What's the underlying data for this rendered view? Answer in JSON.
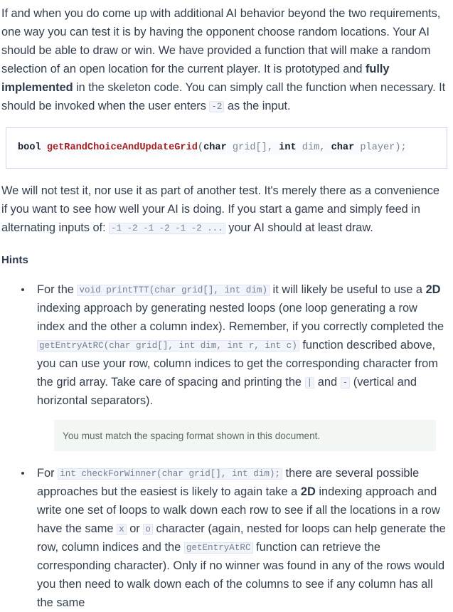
{
  "document": {
    "paragraph_1": {
      "part_1": "If and when you do come up with additional AI behavior beyond the two requirements, one way you can test it is by having the opponent choose random locations. Your AI should be able to draw or win. We have provided a function that will make a random selection of an open location for the current player. It is prototyped and ",
      "bold_1": "fully implemented",
      "part_2": " in the skeleton code. You can simply call the function when necessary. It should be invoked when the user enters ",
      "code_1": "-2",
      "part_3": " as the input."
    },
    "code_block": {
      "tokens": [
        {
          "text": "bool",
          "type": "keyword"
        },
        {
          "text": " ",
          "type": "plain"
        },
        {
          "text": "getRandChoiceAndUpdateGrid",
          "type": "function"
        },
        {
          "text": "(",
          "type": "punct"
        },
        {
          "text": "char",
          "type": "keyword"
        },
        {
          "text": " grid[], ",
          "type": "plain"
        },
        {
          "text": "int",
          "type": "keyword"
        },
        {
          "text": " dim, ",
          "type": "plain"
        },
        {
          "text": "char",
          "type": "keyword"
        },
        {
          "text": " player);",
          "type": "plain"
        }
      ],
      "full_text": "bool getRandChoiceAndUpdateGrid(char grid[], int dim, char player);",
      "return_type": "bool",
      "function_name": "getRandChoiceAndUpdateGrid",
      "params": "(char grid[], int dim, char player);"
    },
    "paragraph_2": {
      "part_1": "We will not test it, nor use it as part of another test. It's merely there as a convenience if you want to see how well your AI is doing. If you start a game and simply feed in alternating inputs of: ",
      "code_1": "-1 -2 -1 -2 -1 -2 ...",
      "part_2": " your AI should at least draw."
    },
    "hints_heading": "Hints",
    "hints": [
      {
        "part_1": "For the ",
        "code_1": "void printTTT(char grid[], int dim)",
        "part_2": " it will likely be useful to use a ",
        "bold_1": "2D",
        "part_3": " indexing approach by generating nested loops (one loop generating a row index and the other a column index). Remember, if you correctly completed the ",
        "code_2": "getEntryAtRC(char grid[], int dim, int r, int c)",
        "part_4": " function described above, you can use your row, column indices to get the corresponding character from the grid array. Take care of spacing and printing the ",
        "code_3": "|",
        "part_5": " and ",
        "code_4": "-",
        "part_6": " (vertical and horizontal separators).",
        "note": "You must match the spacing format shown in this document."
      },
      {
        "part_1": "For ",
        "code_1": "int checkForWinner(char grid[], int dim);",
        "part_2": " there are several possible approaches but the easiest is likely to again take a ",
        "bold_1": "2D",
        "part_3": " indexing approach and write one set of loops to walk down each row to see if all the locations in a row have the same ",
        "code_2": "x",
        "part_4": " or ",
        "code_3": "o",
        "part_5": " character (again, nested for loops can help generate the row, column indices and the ",
        "code_4": "getEntryAtRC",
        "part_6": " function can retrieve the corresponding character). Only if no winner was found in any of the rows would you then need to walk down each of the columns to see if any column has all the same"
      }
    ],
    "colors": {
      "body_text": "#34404f",
      "heading": "#2b3950",
      "inline_code_bg": "#f1f4fa",
      "inline_code_border": "#dfe5f2",
      "inline_code_text": "#76808f",
      "code_block_border": "#ccd6ec",
      "code_keyword": "#19202b",
      "code_function": "#a41f21",
      "code_plain": "#7c8593",
      "note_bg": "#f2f7f3",
      "note_text": "#5b6b5f"
    }
  }
}
